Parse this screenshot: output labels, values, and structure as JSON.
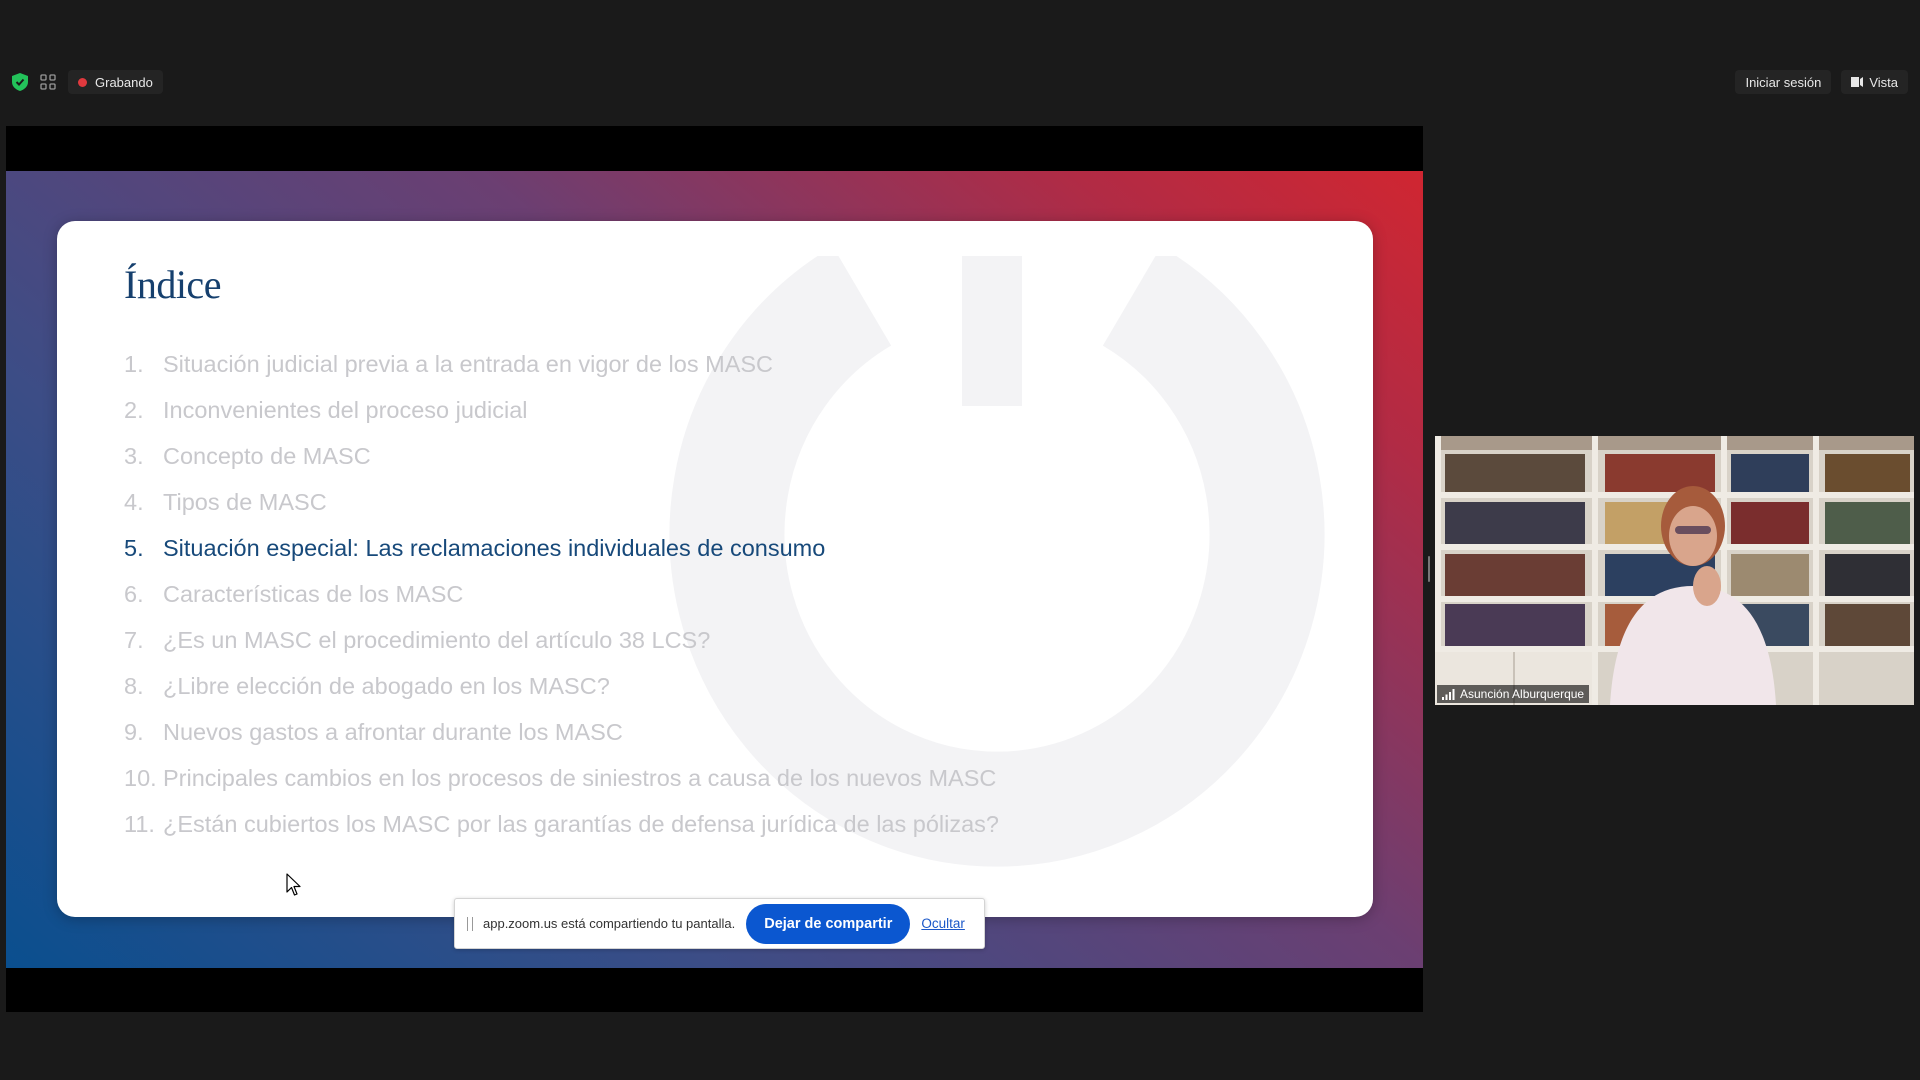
{
  "topbar": {
    "recording_label": "Grabando",
    "signin_label": "Iniciar sesión",
    "view_label": "Vista"
  },
  "slide": {
    "title": "Índice",
    "items": [
      {
        "num": "1.",
        "text": "Situación judicial previa a la entrada en vigor de los MASC"
      },
      {
        "num": "2.",
        "text": "Inconvenientes del proceso judicial"
      },
      {
        "num": "3.",
        "text": "Concepto de MASC"
      },
      {
        "num": "4.",
        "text": "Tipos de MASC"
      },
      {
        "num": "5.",
        "text": "Situación especial: Las reclamaciones individuales de consumo"
      },
      {
        "num": "6.",
        "text": "Características de los MASC"
      },
      {
        "num": "7.",
        "text": "¿Es un MASC el procedimiento del artículo 38 LCS?"
      },
      {
        "num": "8.",
        "text": "¿Libre elección de abogado en los MASC?"
      },
      {
        "num": "9.",
        "text": "Nuevos gastos a afrontar durante los MASC"
      },
      {
        "num": "10.",
        "text": "Principales cambios en los procesos de siniestros a causa de los nuevos MASC"
      },
      {
        "num": "11.",
        "text": "¿Están cubiertos los MASC por las garantías de defensa jurídica de las pólizas?"
      }
    ],
    "active_item": "5."
  },
  "share_bar": {
    "message": "app.zoom.us está compartiendo tu pantalla.",
    "stop_label": "Dejar de compartir",
    "hide_label": "Ocultar"
  },
  "participant": {
    "name": "Asunción Alburquerque"
  },
  "colors": {
    "background": "#1a1a1a",
    "recording_dot": "#e0393e",
    "security_shield": "#23c25a",
    "slide_title": "#16406e",
    "active_item": "#17497a",
    "inactive_item": "#c8c8cc",
    "stop_button": "#0b57d0"
  },
  "icons": [
    "security-shield-icon",
    "apps-grid-icon",
    "recording-dot-icon",
    "view-icon",
    "signal-icon",
    "mouse-cursor-icon"
  ]
}
